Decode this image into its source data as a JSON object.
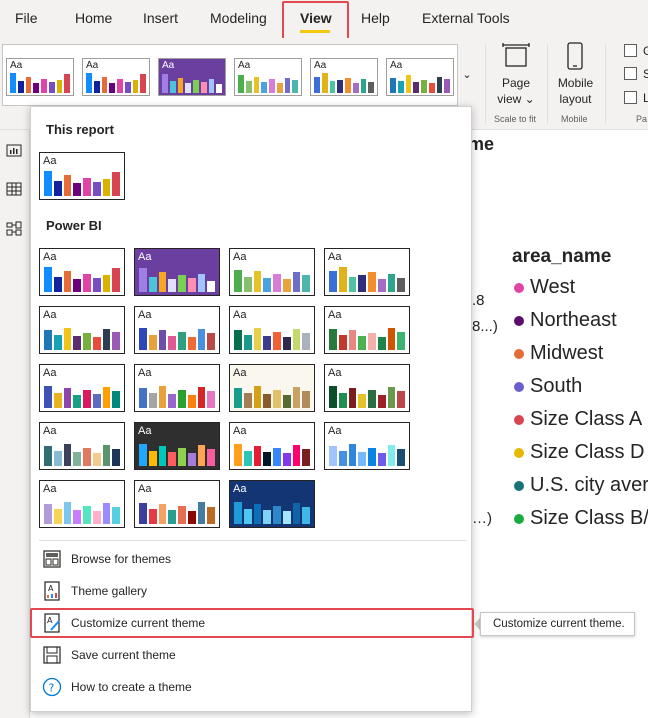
{
  "tabs": [
    "File",
    "Home",
    "Insert",
    "Modeling",
    "View",
    "Help",
    "External Tools"
  ],
  "ribbon": {
    "page_view": [
      "Page",
      "view ⌄"
    ],
    "mobile": [
      "Mobile",
      "layout"
    ],
    "scale_group": "Scale to fit",
    "mobile_group": "Mobile",
    "pa_group": "Pa",
    "checkbox_letters": [
      "G",
      "S",
      "L"
    ]
  },
  "canvas": {
    "title_fragment": "me",
    "legend_title": "area_name",
    "frag1": ".8",
    "frag2": "8...)",
    "frag3": "…)",
    "legend": [
      {
        "label": "West",
        "color": "#e044a7"
      },
      {
        "label": "Northeast",
        "color": "#5b0e6e"
      },
      {
        "label": "Midwest",
        "color": "#e66c37"
      },
      {
        "label": "South",
        "color": "#6b5fce"
      },
      {
        "label": "Size Class A",
        "color": "#d64550"
      },
      {
        "label": "Size Class D",
        "color": "#e6b800"
      },
      {
        "label": "U.S. city avera",
        "color": "#197278"
      },
      {
        "label": "Size Class B/C",
        "color": "#1aab40"
      }
    ]
  },
  "dropdown": {
    "this_report_heading": "This report",
    "power_bi_heading": "Power BI",
    "thumb_text": "Aa",
    "items": [
      {
        "label": "Browse for themes",
        "icon": "browse-icon"
      },
      {
        "label": "Theme gallery",
        "icon": "gallery-icon"
      },
      {
        "label": "Customize current theme",
        "icon": "customize-icon"
      },
      {
        "label": "Save current theme",
        "icon": "save-icon"
      },
      {
        "label": "How to create a theme",
        "icon": "help-icon"
      }
    ]
  },
  "tooltip": "Customize current theme.",
  "themes": [
    {
      "bg": "#ffffff",
      "fg": "#252423",
      "bars": [
        [
          "#118dff",
          0.9
        ],
        [
          "#12239e",
          0.55
        ],
        [
          "#e66c37",
          0.75
        ],
        [
          "#6b007b",
          0.45
        ],
        [
          "#e044a7",
          0.65
        ],
        [
          "#744ec2",
          0.5
        ],
        [
          "#d9b300",
          0.6
        ],
        [
          "#d64550",
          0.85
        ]
      ]
    },
    {
      "bg": "#ffffff",
      "fg": "#252423",
      "bars": [
        [
          "#118dff",
          0.9
        ],
        [
          "#12239e",
          0.55
        ],
        [
          "#e66c37",
          0.75
        ],
        [
          "#6b007b",
          0.45
        ],
        [
          "#e044a7",
          0.65
        ],
        [
          "#744ec2",
          0.5
        ],
        [
          "#d9b300",
          0.6
        ],
        [
          "#d64550",
          0.85
        ]
      ]
    },
    {
      "bg": "#6b3fa0",
      "fg": "#ffffff",
      "bars": [
        [
          "#9f7fe6",
          0.85
        ],
        [
          "#4cc3d9",
          0.55
        ],
        [
          "#f5a623",
          0.7
        ],
        [
          "#e0e0ff",
          0.45
        ],
        [
          "#7ad151",
          0.6
        ],
        [
          "#ff8fb1",
          0.5
        ],
        [
          "#a0c4ff",
          0.65
        ],
        [
          "#ffffff",
          0.4
        ]
      ]
    },
    {
      "bg": "#ffffff",
      "fg": "#252423",
      "bars": [
        [
          "#4cae4c",
          0.8
        ],
        [
          "#86c06c",
          0.55
        ],
        [
          "#e6c229",
          0.75
        ],
        [
          "#4aa3df",
          0.5
        ],
        [
          "#d97bd9",
          0.65
        ],
        [
          "#e8a33d",
          0.45
        ],
        [
          "#6e6ec9",
          0.7
        ],
        [
          "#4db6ac",
          0.6
        ]
      ]
    },
    {
      "bg": "#ffffff",
      "fg": "#252423",
      "bars": [
        [
          "#3a6fd8",
          0.75
        ],
        [
          "#e0b31a",
          0.9
        ],
        [
          "#4fc3a1",
          0.55
        ],
        [
          "#2e2e7a",
          0.6
        ],
        [
          "#f28e2b",
          0.7
        ],
        [
          "#a56cc1",
          0.45
        ],
        [
          "#2ca58d",
          0.65
        ],
        [
          "#5e5e5e",
          0.5
        ]
      ]
    },
    {
      "bg": "#ffffff",
      "fg": "#252423",
      "bars": [
        [
          "#1f77b4",
          0.7
        ],
        [
          "#17a2b8",
          0.55
        ],
        [
          "#f0c419",
          0.8
        ],
        [
          "#5b2c6f",
          0.5
        ],
        [
          "#76b041",
          0.6
        ],
        [
          "#e74c3c",
          0.45
        ],
        [
          "#2c3e50",
          0.75
        ],
        [
          "#9b59b6",
          0.65
        ]
      ]
    },
    {
      "bg": "#ffffff",
      "fg": "#252423",
      "bars": [
        [
          "#2d46b9",
          0.8
        ],
        [
          "#e9a13b",
          0.55
        ],
        [
          "#6e4fa8",
          0.7
        ],
        [
          "#dd5a94",
          0.5
        ],
        [
          "#2fa07f",
          0.65
        ],
        [
          "#f06a35",
          0.45
        ],
        [
          "#4a90e2",
          0.75
        ],
        [
          "#b94a48",
          0.6
        ]
      ]
    },
    {
      "bg": "#ffffff",
      "fg": "#252423",
      "bars": [
        [
          "#0b6e4f",
          0.7
        ],
        [
          "#1b998b",
          0.55
        ],
        [
          "#e7d049",
          0.8
        ],
        [
          "#3d3b8e",
          0.5
        ],
        [
          "#f46036",
          0.65
        ],
        [
          "#2e294e",
          0.45
        ],
        [
          "#c5d86d",
          0.75
        ],
        [
          "#aab2bd",
          0.6
        ]
      ]
    },
    {
      "bg": "#ffffff",
      "fg": "#252423",
      "bars": [
        [
          "#2b7a3d",
          0.75
        ],
        [
          "#c0392b",
          0.55
        ],
        [
          "#e8887f",
          0.7
        ],
        [
          "#4caf50",
          0.5
        ],
        [
          "#f3b0a8",
          0.6
        ],
        [
          "#1e8449",
          0.45
        ],
        [
          "#d35400",
          0.8
        ],
        [
          "#3cb371",
          0.65
        ]
      ]
    },
    {
      "bg": "#ffffff",
      "fg": "#252423",
      "bars": [
        [
          "#3f51b5",
          0.8
        ],
        [
          "#e6b422",
          0.55
        ],
        [
          "#8e44ad",
          0.7
        ],
        [
          "#16a085",
          0.45
        ],
        [
          "#d81b60",
          0.65
        ],
        [
          "#5c6bc0",
          0.5
        ],
        [
          "#ffa000",
          0.75
        ],
        [
          "#00897b",
          0.6
        ]
      ]
    },
    {
      "bg": "#ffffff",
      "fg": "#252423",
      "bars": [
        [
          "#4472c4",
          0.7
        ],
        [
          "#a5a5a5",
          0.55
        ],
        [
          "#e6a23c",
          0.8
        ],
        [
          "#9966cc",
          0.5
        ],
        [
          "#2ca02c",
          0.65
        ],
        [
          "#ff7f0e",
          0.45
        ],
        [
          "#d62728",
          0.75
        ],
        [
          "#e377c2",
          0.6
        ]
      ]
    },
    {
      "bg": "#faf7ef",
      "fg": "#252423",
      "bars": [
        [
          "#1a9c8c",
          0.7
        ],
        [
          "#a67c52",
          0.55
        ],
        [
          "#d4a017",
          0.8
        ],
        [
          "#8b5a2b",
          0.5
        ],
        [
          "#e0c068",
          0.65
        ],
        [
          "#556b2f",
          0.45
        ],
        [
          "#c8a165",
          0.75
        ],
        [
          "#b28b5a",
          0.6
        ]
      ]
    },
    {
      "bg": "#ffffff",
      "fg": "#252423",
      "bars": [
        [
          "#0d4f2b",
          0.8
        ],
        [
          "#1e8f4e",
          0.55
        ],
        [
          "#7a1e1e",
          0.7
        ],
        [
          "#e6c229",
          0.5
        ],
        [
          "#2a6e3f",
          0.65
        ],
        [
          "#9b2226",
          0.45
        ],
        [
          "#6a994e",
          0.75
        ],
        [
          "#bc4749",
          0.6
        ]
      ]
    },
    {
      "bg": "#ffffff",
      "fg": "#252423",
      "bars": [
        [
          "#2f6f73",
          0.7
        ],
        [
          "#86bbd8",
          0.55
        ],
        [
          "#3d405b",
          0.8
        ],
        [
          "#81b29a",
          0.5
        ],
        [
          "#e07a5f",
          0.65
        ],
        [
          "#f2cc8f",
          0.45
        ],
        [
          "#5c946e",
          0.75
        ],
        [
          "#1d3557",
          0.6
        ]
      ]
    },
    {
      "bg": "#2f2f2f",
      "fg": "#ffffff",
      "bars": [
        [
          "#1ea7fd",
          0.8
        ],
        [
          "#ffb900",
          0.55
        ],
        [
          "#00c7b7",
          0.7
        ],
        [
          "#ff5c5c",
          0.5
        ],
        [
          "#8fd14f",
          0.65
        ],
        [
          "#a77bdb",
          0.45
        ],
        [
          "#ffa552",
          0.75
        ],
        [
          "#f75c9e",
          0.6
        ]
      ]
    },
    {
      "bg": "#ffffff",
      "fg": "#252423",
      "bars": [
        [
          "#ff9f1c",
          0.8
        ],
        [
          "#2ec4b6",
          0.55
        ],
        [
          "#e71d36",
          0.7
        ],
        [
          "#011627",
          0.5
        ],
        [
          "#3a86ff",
          0.65
        ],
        [
          "#8338ec",
          0.45
        ],
        [
          "#ff006e",
          0.75
        ],
        [
          "#7b1e1e",
          0.6
        ]
      ]
    },
    {
      "bg": "#ffffff",
      "fg": "#252423",
      "bars": [
        [
          "#9ec5fe",
          0.7
        ],
        [
          "#4a90e2",
          0.55
        ],
        [
          "#2e86de",
          0.8
        ],
        [
          "#74b9ff",
          0.5
        ],
        [
          "#0984e3",
          0.65
        ],
        [
          "#6c5ce7",
          0.45
        ],
        [
          "#81ecec",
          0.75
        ],
        [
          "#1b4f72",
          0.6
        ]
      ]
    },
    {
      "bg": "#ffffff",
      "fg": "#252423",
      "bars": [
        [
          "#b19cd9",
          0.7
        ],
        [
          "#f7d358",
          0.55
        ],
        [
          "#7dc6f0",
          0.8
        ],
        [
          "#c77dff",
          0.5
        ],
        [
          "#55e6c1",
          0.65
        ],
        [
          "#ffafcc",
          0.45
        ],
        [
          "#9a8cff",
          0.75
        ],
        [
          "#56cfe1",
          0.6
        ]
      ]
    },
    {
      "bg": "#ffffff",
      "fg": "#252423",
      "bars": [
        [
          "#3a3f9e",
          0.75
        ],
        [
          "#e63946",
          0.55
        ],
        [
          "#f4a261",
          0.7
        ],
        [
          "#2a9d8f",
          0.5
        ],
        [
          "#e76f51",
          0.65
        ],
        [
          "#8d0801",
          0.45
        ],
        [
          "#457b9d",
          0.8
        ],
        [
          "#bc6c25",
          0.6
        ]
      ]
    },
    {
      "bg": "#143574",
      "fg": "#ffffff",
      "bars": [
        [
          "#1f9bd7",
          0.8
        ],
        [
          "#4ec8f0",
          0.55
        ],
        [
          "#0d6fb8",
          0.7
        ],
        [
          "#7fd3f4",
          0.5
        ],
        [
          "#2b89c9",
          0.65
        ],
        [
          "#a5e4ff",
          0.45
        ],
        [
          "#1262a6",
          0.75
        ],
        [
          "#3fb7e8",
          0.6
        ]
      ]
    },
    {
      "bg": "#ffffff",
      "fg": "#252423",
      "bars": [
        [
          "#e07b39",
          0.75
        ],
        [
          "#2e6f95",
          0.55
        ],
        [
          "#c9a227",
          0.7
        ],
        [
          "#8fb996",
          0.5
        ],
        [
          "#b05b3b",
          0.65
        ],
        [
          "#457b9d",
          0.45
        ],
        [
          "#e9c46a",
          0.8
        ],
        [
          "#6d597a",
          0.6
        ]
      ]
    }
  ],
  "strip": [
    0,
    1,
    2,
    3,
    4,
    5
  ]
}
